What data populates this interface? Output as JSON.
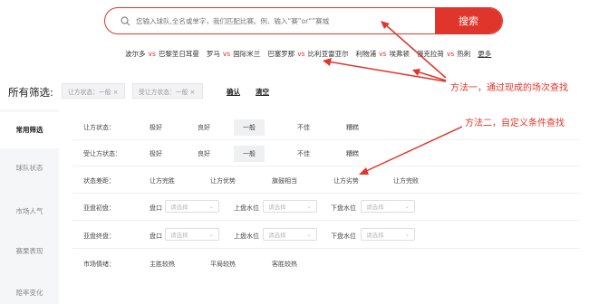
{
  "search": {
    "placeholder": "您输入球队,全名或单字，我们匹配比赛。例、输入“赛”or“”赛城",
    "button_label": "搜索"
  },
  "quick_matches": [
    {
      "home": "波尔多",
      "vs": "vs",
      "away": "巴黎圣日耳曼"
    },
    {
      "home": "罗马",
      "vs": "vs",
      "away": "国际米兰"
    },
    {
      "home": "巴塞罗那",
      "vs": "vs",
      "away": "比利亚雷亚尔"
    },
    {
      "home": "利物浦",
      "vs": "vs",
      "away": "埃弗顿"
    },
    {
      "home": "俄克拉荷",
      "vs": "vs",
      "away": "热刺"
    }
  ],
  "quick_more": "更多",
  "filters": {
    "title": "所有筛选:",
    "chips": [
      "让方状态：一般 ×",
      "受让方状态：一般 ×"
    ],
    "confirm": "确认",
    "clear": "清空"
  },
  "side_tabs": [
    "常用筛选",
    "球队状态",
    "市场人气",
    "赛果表现",
    "赔率变化"
  ],
  "rows": {
    "giver_state": {
      "label": "让方状态：",
      "options": [
        "极好",
        "良好",
        "一般",
        "不佳",
        "糟糕"
      ],
      "selected": "一般"
    },
    "receiver_state": {
      "label": "受让方状态：",
      "options": [
        "极好",
        "良好",
        "一般",
        "不佳",
        "糟糕"
      ],
      "selected": "一般"
    },
    "state_gap": {
      "label": "状态差距：",
      "options": [
        "让方完胜",
        "让方优势",
        "旗鼓相当",
        "让方劣势",
        "让方完败"
      ]
    },
    "asia_open": {
      "label": "亚盘初盘：",
      "fields": [
        "盘口",
        "上盘水位",
        "下盘水位"
      ],
      "placeholder": "请选择"
    },
    "asia_close": {
      "label": "亚盘终盘：",
      "fields": [
        "盘口",
        "上盘水位",
        "下盘水位"
      ],
      "placeholder": "请选择"
    },
    "market": {
      "label": "市场情绪：",
      "options": [
        "主胜较热",
        "平局较热",
        "客胜较热"
      ]
    }
  },
  "annotations": {
    "method1": "方法一，通过现成的场次查找",
    "method2": "方法二，自定义条件查找"
  },
  "colors": {
    "accent": "#e0352b"
  }
}
